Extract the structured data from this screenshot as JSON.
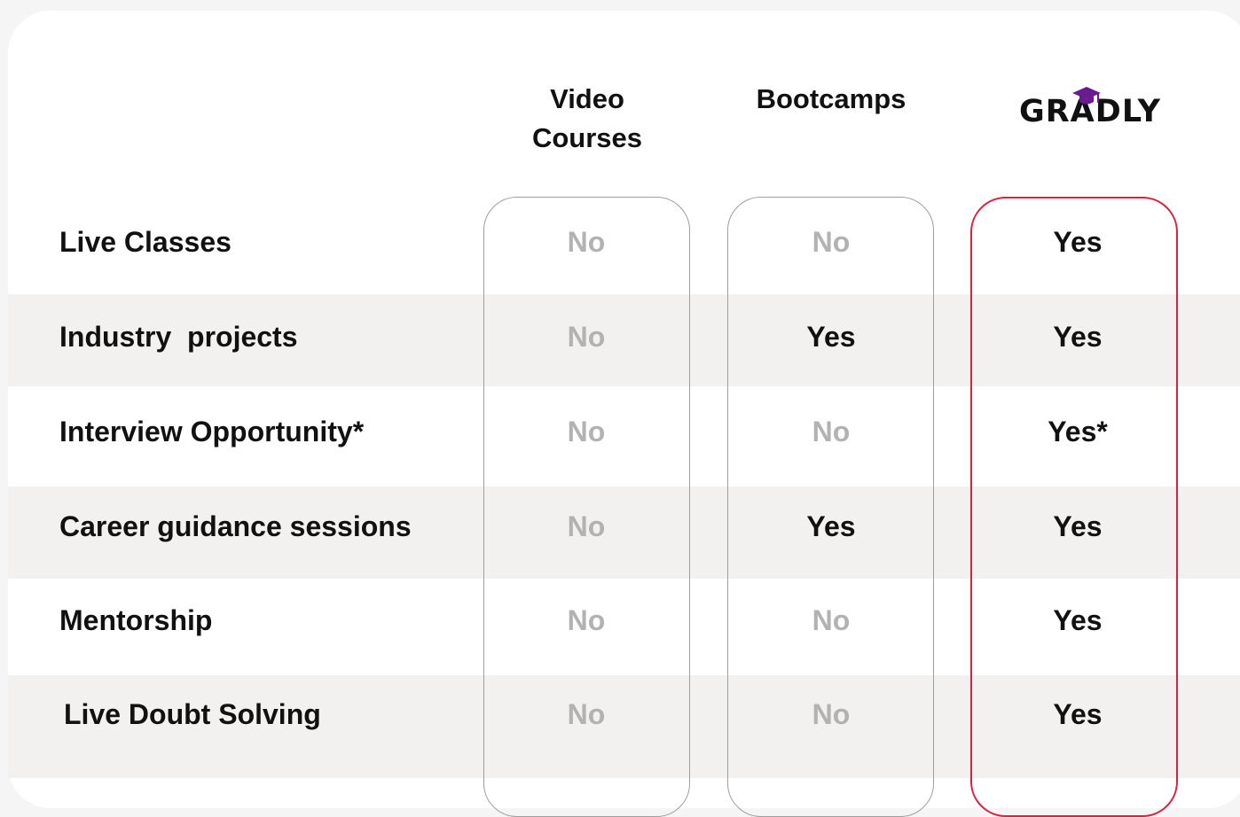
{
  "columns": {
    "video_courses": "Video\nCourses",
    "bootcamps": "Bootcamps",
    "brand": "GRADLY"
  },
  "colors": {
    "highlight": "#d6213f",
    "band": "#f2f1f0",
    "cap": "#6a1b8f",
    "no_text": "#b2b2b2"
  },
  "rows": [
    {
      "label": "Live Classes",
      "video": "No",
      "bootcamp": "No",
      "gradly": "Yes"
    },
    {
      "label": "Industry  projects",
      "video": "No",
      "bootcamp": "Yes",
      "gradly": "Yes"
    },
    {
      "label": "Interview Opportunity*",
      "video": "No",
      "bootcamp": "No",
      "gradly": "Yes*"
    },
    {
      "label": "Career guidance sessions",
      "video": "No",
      "bootcamp": "Yes",
      "gradly": "Yes"
    },
    {
      "label": "Mentorship",
      "video": "No",
      "bootcamp": "No",
      "gradly": "Yes"
    },
    {
      "label": "Live Doubt Solving",
      "video": "No",
      "bootcamp": "No",
      "gradly": "Yes"
    }
  ]
}
